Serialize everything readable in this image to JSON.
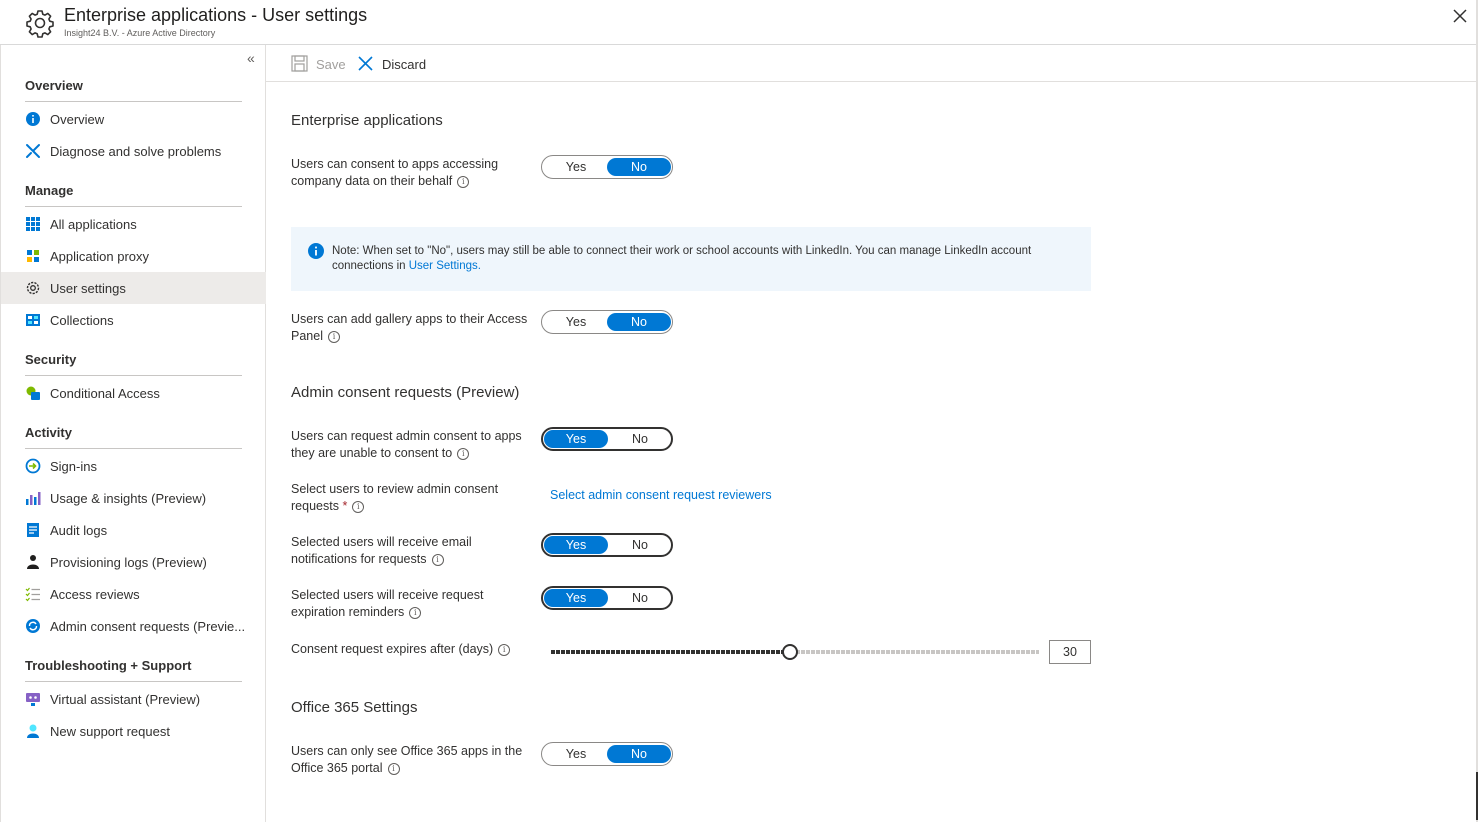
{
  "header": {
    "title": "Enterprise applications - User settings",
    "subtitle": "Insight24 B.V. - Azure Active Directory"
  },
  "sidebar": {
    "sections": [
      {
        "title": "Overview",
        "items": [
          {
            "label": "Overview",
            "icon": "info-icon"
          },
          {
            "label": "Diagnose and solve problems",
            "icon": "wrench-icon"
          }
        ]
      },
      {
        "title": "Manage",
        "items": [
          {
            "label": "All applications",
            "icon": "grid-icon"
          },
          {
            "label": "Application proxy",
            "icon": "app-proxy-icon"
          },
          {
            "label": "User settings",
            "icon": "gear-icon",
            "selected": true
          },
          {
            "label": "Collections",
            "icon": "collections-icon"
          }
        ]
      },
      {
        "title": "Security",
        "items": [
          {
            "label": "Conditional Access",
            "icon": "conditional-access-icon"
          }
        ]
      },
      {
        "title": "Activity",
        "items": [
          {
            "label": "Sign-ins",
            "icon": "sign-in-icon"
          },
          {
            "label": "Usage & insights (Preview)",
            "icon": "chart-icon"
          },
          {
            "label": "Audit logs",
            "icon": "audit-log-icon"
          },
          {
            "label": "Provisioning logs (Preview)",
            "icon": "person-icon"
          },
          {
            "label": "Access reviews",
            "icon": "checklist-icon"
          },
          {
            "label": "Admin consent requests (Previe...",
            "icon": "refresh-icon"
          }
        ]
      },
      {
        "title": "Troubleshooting + Support",
        "items": [
          {
            "label": "Virtual assistant (Preview)",
            "icon": "assistant-icon"
          },
          {
            "label": "New support request",
            "icon": "support-person-icon"
          }
        ]
      }
    ]
  },
  "toolbar": {
    "save_label": "Save",
    "discard_label": "Discard"
  },
  "main": {
    "enterprise": {
      "title": "Enterprise applications",
      "consent_label": "Users can consent to apps accessing company data on their behalf",
      "consent_value": "No",
      "note_text": "Note: When set to \"No\", users may still be able to connect their work or school accounts with LinkedIn. You can manage LinkedIn account connections in ",
      "note_link": "User Settings.",
      "gallery_label": "Users can add gallery apps to their Access Panel",
      "gallery_value": "No"
    },
    "admin": {
      "title": "Admin consent requests (Preview)",
      "request_label": "Users can request admin consent to apps they are unable to consent to",
      "request_value": "Yes",
      "reviewers_label": "Select users to review admin consent requests",
      "reviewers_required": "*",
      "reviewers_link": "Select admin consent request reviewers",
      "email_label": "Selected users will receive email notifications for requests",
      "email_value": "Yes",
      "reminder_label": "Selected users will receive request expiration reminders",
      "reminder_value": "Yes",
      "expires_label": "Consent request expires after (days)",
      "expires_value": "30",
      "expires_fraction": 0.49
    },
    "office": {
      "title": "Office 365 Settings",
      "only_label": "Users can only see Office 365 apps in the Office 365 portal",
      "only_value": "No"
    },
    "toggle_yes": "Yes",
    "toggle_no": "No"
  },
  "colors": {
    "accent": "#0078d4",
    "selected_nav": "#edebe9",
    "info_background": "#eff6fc"
  }
}
